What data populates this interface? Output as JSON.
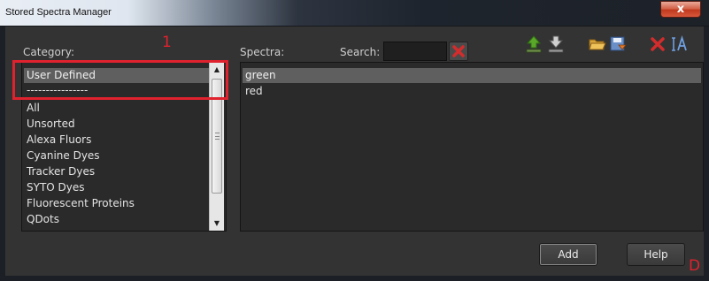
{
  "window": {
    "title": "Stored Spectra Manager",
    "close_label": "x"
  },
  "category": {
    "label": "Category:",
    "items": [
      "User Defined",
      "----------------",
      "All",
      "Unsorted",
      "Alexa Fluors",
      "Cyanine Dyes",
      "Tracker Dyes",
      "SYTO Dyes",
      "Fluorescent Proteins",
      "QDots"
    ],
    "selected_index": 0
  },
  "spectra": {
    "label": "Spectra:",
    "search_label": "Search:",
    "search_value": "",
    "items": [
      "green",
      "red"
    ],
    "selected_index": 0
  },
  "toolbar": {
    "icons": [
      "upload-icon",
      "download-icon",
      "open-folder-icon",
      "save-icon",
      "delete-icon",
      "rename-icon"
    ],
    "accent_green": "#5aa829",
    "accent_red": "#d22c2c"
  },
  "buttons": {
    "add_label": "Add",
    "help_label": "Help"
  },
  "annotations": {
    "marker_1": "1",
    "marker_d": "D",
    "color": "#e0222e"
  }
}
